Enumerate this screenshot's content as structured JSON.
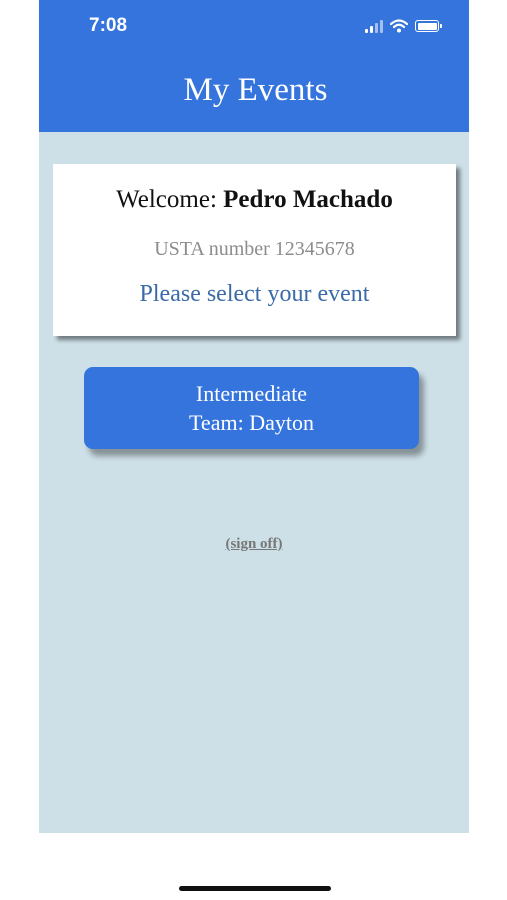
{
  "status_bar": {
    "time": "7:08",
    "icons": [
      "signal-icon",
      "wifi-icon",
      "battery-icon"
    ]
  },
  "header": {
    "title": "My Events"
  },
  "welcome_card": {
    "welcome_prefix": "Welcome:",
    "user_name": "Pedro Machado",
    "usta_number": "USTA number 12345678",
    "instruction": "Please select your event"
  },
  "events": [
    {
      "level": "Intermediate",
      "team": "Team: Dayton"
    }
  ],
  "sign_off_label": "(sign off)",
  "colors": {
    "header_blue": "#3474dc",
    "background": "#cddfe7",
    "instruction_text": "#3a6aa8"
  }
}
